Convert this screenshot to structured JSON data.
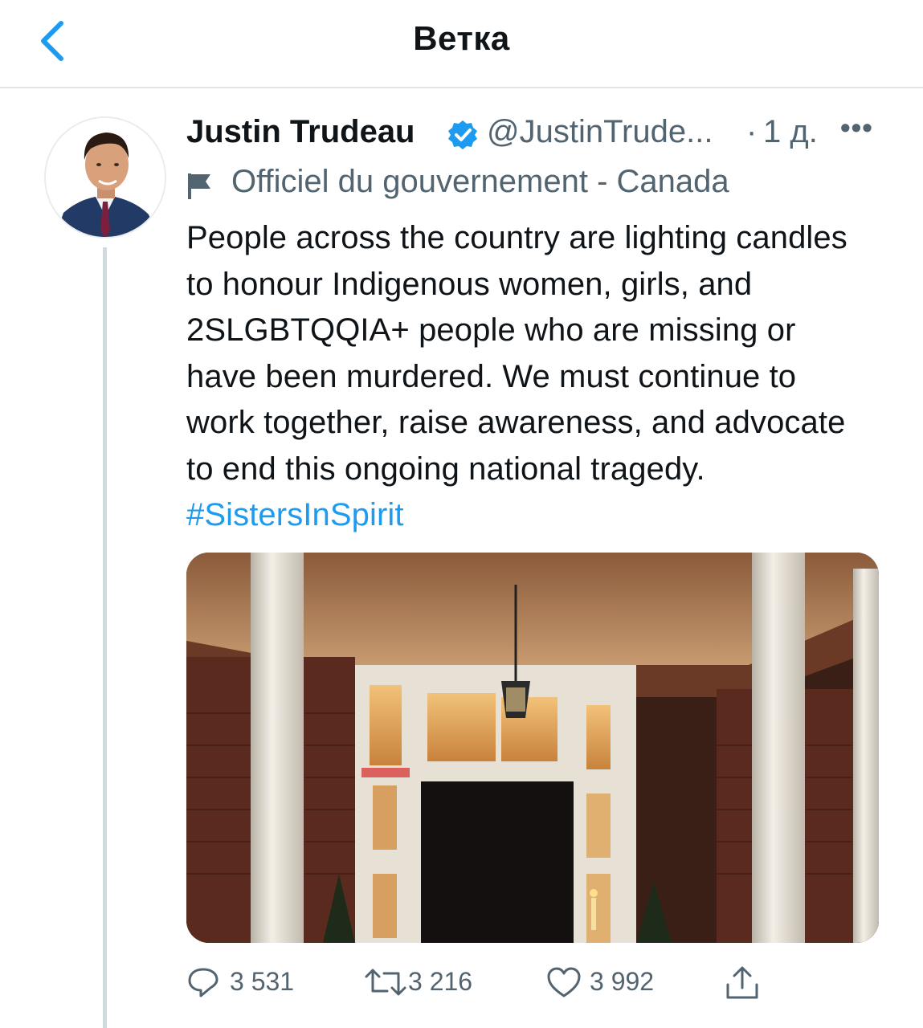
{
  "nav": {
    "title": "Ветка"
  },
  "tweet": {
    "author_name": "Justin Trudeau",
    "handle": "@JustinTrude...",
    "separator": "·",
    "time": "1 д.",
    "more": "•••",
    "label": "Officiel du gouvernement - Canada",
    "text": "People across the country are lighting candles to honour Indigenous women, girls, and 2SLGBTQQIA+ people who are missing or have been murdered. We must continue to work together, raise awareness, and advocate to end this ongoing national tragedy. ",
    "hashtag": "#SistersInSpirit"
  },
  "actions": {
    "replies": "3 531",
    "retweets": "3 216",
    "likes": "3 992"
  },
  "icons": [
    "back-chevron-icon",
    "verified-badge-icon",
    "government-flag-icon",
    "reply-icon",
    "retweet-icon",
    "like-icon",
    "share-icon"
  ],
  "colors": {
    "accent": "#1d9bf0",
    "secondary_text": "#536471",
    "divider": "#e1e4e6",
    "thread_line": "#cfd9de"
  }
}
